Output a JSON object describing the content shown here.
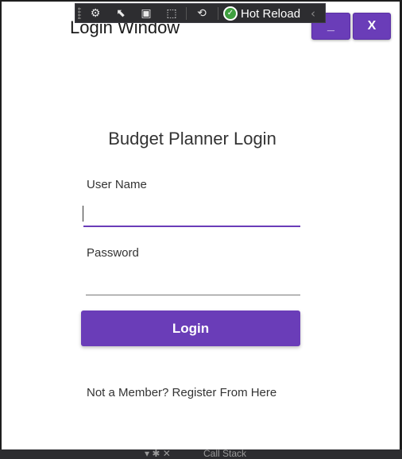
{
  "window": {
    "title": "Login Window",
    "minimize_label": "_",
    "close_label": "X"
  },
  "debug_toolbar": {
    "hot_reload_label": "Hot Reload"
  },
  "login": {
    "heading": "Budget Planner Login",
    "username_label": "User Name",
    "username_value": "",
    "password_label": "Password",
    "password_value": "",
    "login_button": "Login",
    "register_link": "Not a Member? Register From Here"
  },
  "background": {
    "bottom_panel_label": "Call Stack"
  },
  "colors": {
    "accent": "#6a3db8",
    "window_bg": "#ffffff",
    "toolbar_bg": "#2d2d30"
  }
}
